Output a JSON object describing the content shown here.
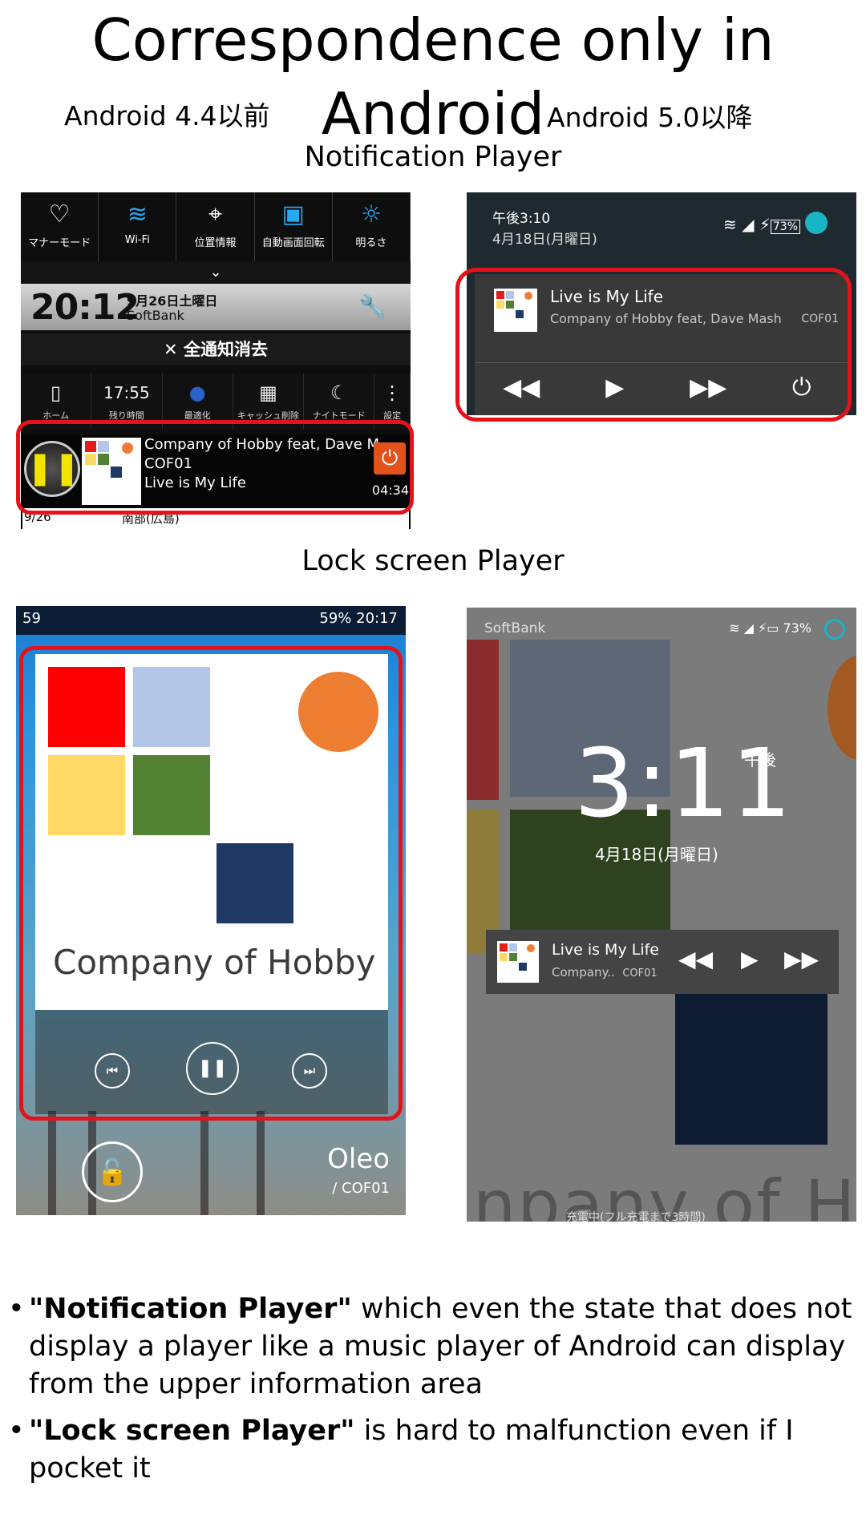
{
  "title": "Correspondence only in Android",
  "headers": {
    "left": "Android 4.4以前",
    "right": "Android 5.0以降"
  },
  "sections": {
    "notification": "Notification Player",
    "lockscreen": "Lock screen Player"
  },
  "old_notification": {
    "quick_settings": [
      {
        "icon": "manner-mode-icon",
        "label": "マナーモード"
      },
      {
        "icon": "wifi-icon",
        "label": "Wi-Fi"
      },
      {
        "icon": "location-icon",
        "label": "位置情報"
      },
      {
        "icon": "auto-rotate-icon",
        "label": "自動画面回転"
      },
      {
        "icon": "brightness-icon",
        "label": "明るさ"
      }
    ],
    "clock": "20:12",
    "date": "9月26日土曜日",
    "carrier": "SoftBank",
    "clear_all": "✕ 全通知消去",
    "tools": [
      {
        "icon": "phone-icon",
        "label": "ホーム"
      },
      {
        "icon": "remaining-time-icon",
        "label": "残り時間",
        "value": "17:55"
      },
      {
        "icon": "optimize-icon",
        "label": "最適化"
      },
      {
        "icon": "cache-clear-icon",
        "label": "キャッシュ削除"
      },
      {
        "icon": "night-mode-icon",
        "label": "ナイトモード"
      },
      {
        "icon": "more-icon",
        "label": "設定"
      }
    ],
    "player": {
      "artist": "Company of Hobby feat, Dave M",
      "code": "COF01",
      "track": "Live is My Life",
      "time": "04:34"
    },
    "below_row": {
      "date": "9/26",
      "place": "南部(広島)"
    }
  },
  "new_notification": {
    "time": "午後3:10",
    "date": "4月18日(月曜日)",
    "battery": "73%",
    "player": {
      "track": "Live is My Life",
      "artist": "Company of Hobby feat, Dave Mash",
      "code": "COF01"
    }
  },
  "old_lockscreen": {
    "status_right": "59% 20:17",
    "status_left": "59",
    "album": "Company of Hobby",
    "track": "Oleo",
    "code": "/ COF01"
  },
  "new_lockscreen": {
    "carrier": "SoftBank",
    "battery": "73%",
    "clock": "3:11",
    "ampm": "午後",
    "date": "4月18日(月曜日)",
    "player": {
      "track": "Live is My Life",
      "artist": "Company..",
      "code": "COF01"
    },
    "bg_text": "npany of Hob",
    "charging": "充電中(フル充電まで3時間)"
  },
  "bullets": [
    {
      "quoted": "\"Notification Player\"",
      "rest": " which even the state that does not display a player like a music player of Android can display from the upper information area"
    },
    {
      "quoted": "\"Lock screen Player\"",
      "rest": " is hard to malfunction even if I pocket it"
    }
  ],
  "colors": {
    "highlight": "#e4121b",
    "accent_blue": "#2aa8f0",
    "teal": "#19b5c4"
  }
}
